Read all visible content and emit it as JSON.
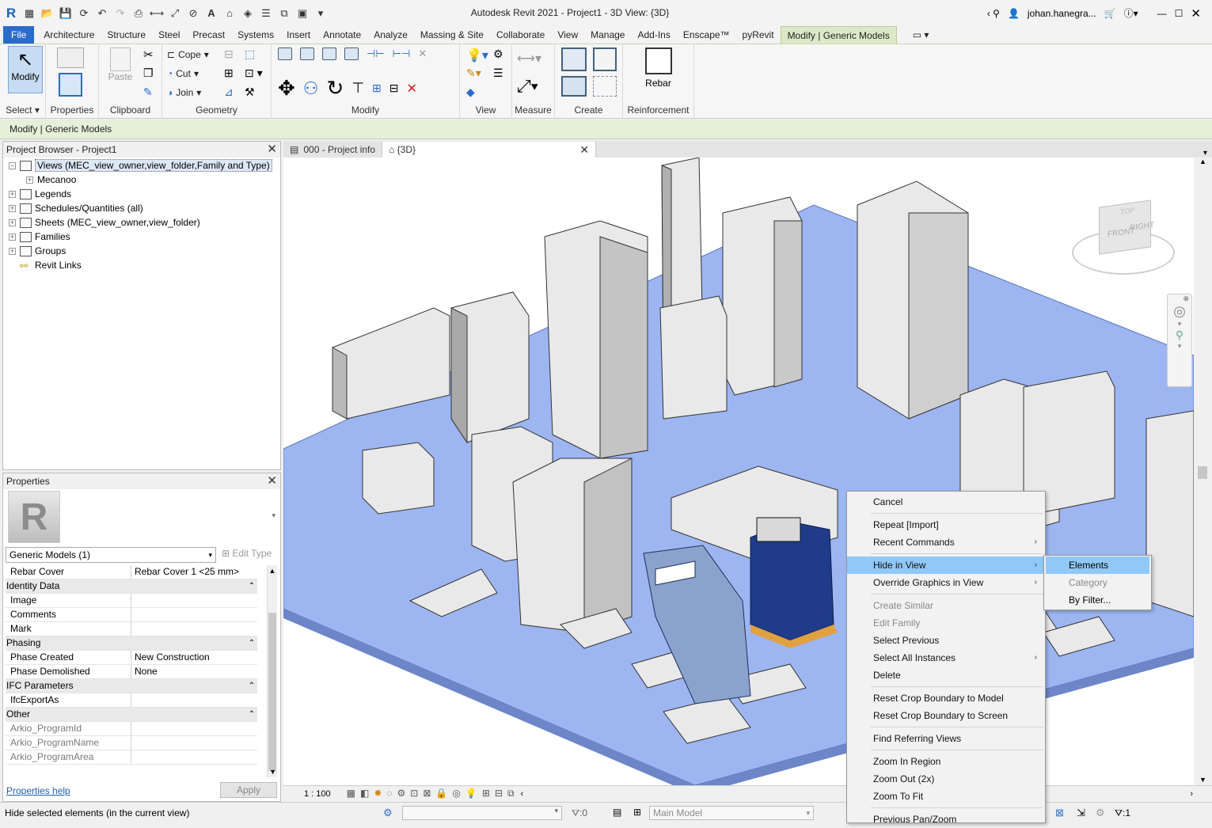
{
  "window": {
    "title": "Autodesk Revit 2021 - Project1 - 3D View: {3D}",
    "user": "johan.hanegra..."
  },
  "menu": {
    "file": "File",
    "tabs": [
      "Architecture",
      "Structure",
      "Steel",
      "Precast",
      "Systems",
      "Insert",
      "Annotate",
      "Analyze",
      "Massing & Site",
      "Collaborate",
      "View",
      "Manage",
      "Add-Ins",
      "Enscape™",
      "pyRevit"
    ],
    "active_tab": "Modify | Generic Models"
  },
  "ribbon": {
    "modify_label": "Modify",
    "paste_label": "Paste",
    "cope_label": "Cope",
    "cut_label": "Cut",
    "join_label": "Join",
    "rebar_label": "Rebar",
    "panels": {
      "select": "Select",
      "properties": "Properties",
      "clipboard": "Clipboard",
      "geometry": "Geometry",
      "modify": "Modify",
      "view": "View",
      "measure": "Measure",
      "create": "Create",
      "reinforcement": "Reinforcement"
    }
  },
  "context_bar": "Modify | Generic Models",
  "project_browser": {
    "title": "Project Browser - Project1",
    "items": [
      {
        "label": "Views (MEC_view_owner,view_folder,Family and Type)",
        "level": 0,
        "selected": true
      },
      {
        "label": "Mecanoo",
        "level": 1
      },
      {
        "label": "Legends",
        "level": 0
      },
      {
        "label": "Schedules/Quantities (all)",
        "level": 0
      },
      {
        "label": "Sheets (MEC_view_owner,view_folder)",
        "level": 0
      },
      {
        "label": "Families",
        "level": 0
      },
      {
        "label": "Groups",
        "level": 0
      },
      {
        "label": "Revit Links",
        "level": 0
      }
    ]
  },
  "properties": {
    "title": "Properties",
    "type_selector": "Generic Models (1)",
    "edit_type": "Edit Type",
    "rows": [
      {
        "kind": "prop",
        "key": "Rebar Cover",
        "value": "Rebar Cover 1 <25 mm>"
      },
      {
        "kind": "group",
        "key": "Identity Data"
      },
      {
        "kind": "prop",
        "key": "Image",
        "value": ""
      },
      {
        "kind": "prop",
        "key": "Comments",
        "value": ""
      },
      {
        "kind": "prop",
        "key": "Mark",
        "value": ""
      },
      {
        "kind": "group",
        "key": "Phasing"
      },
      {
        "kind": "prop",
        "key": "Phase Created",
        "value": "New Construction"
      },
      {
        "kind": "prop",
        "key": "Phase Demolished",
        "value": "None"
      },
      {
        "kind": "group",
        "key": "IFC Parameters"
      },
      {
        "kind": "prop",
        "key": "IfcExportAs",
        "value": ""
      },
      {
        "kind": "group",
        "key": "Other"
      },
      {
        "kind": "dim",
        "key": "Arkio_ProgramId",
        "value": ""
      },
      {
        "kind": "dim",
        "key": "Arkio_ProgramName",
        "value": ""
      },
      {
        "kind": "dim",
        "key": "Arkio_ProgramArea",
        "value": ""
      }
    ],
    "help_link": "Properties help",
    "apply": "Apply"
  },
  "view_tabs": [
    {
      "label": "000 - Project info",
      "active": false
    },
    {
      "label": "{3D}",
      "active": true
    }
  ],
  "viewcube": {
    "top": "TOP",
    "front": "FRONT",
    "right": "RIGHT"
  },
  "view_control": {
    "scale": "1 : 100"
  },
  "status_bar": {
    "message": "Hide selected elements (in the current view)",
    "selection_count": ":0",
    "model": "Main Model",
    "filter_count": ":1"
  },
  "context_menu": {
    "items": [
      {
        "label": "Cancel"
      },
      {
        "sep": true
      },
      {
        "label": "Repeat [Import]"
      },
      {
        "label": "Recent Commands",
        "submenu": true
      },
      {
        "sep": true
      },
      {
        "label": "Hide in View",
        "submenu": true,
        "highlight": true
      },
      {
        "label": "Override Graphics in View",
        "submenu": true
      },
      {
        "sep": true
      },
      {
        "label": "Create Similar",
        "disabled": true
      },
      {
        "label": "Edit Family",
        "disabled": true
      },
      {
        "label": "Select Previous"
      },
      {
        "label": "Select All Instances",
        "submenu": true
      },
      {
        "label": "Delete"
      },
      {
        "sep": true
      },
      {
        "label": "Reset Crop Boundary to Model"
      },
      {
        "label": "Reset Crop Boundary to Screen"
      },
      {
        "sep": true
      },
      {
        "label": "Find Referring Views"
      },
      {
        "sep": true
      },
      {
        "label": "Zoom In Region"
      },
      {
        "label": "Zoom Out (2x)"
      },
      {
        "label": "Zoom To Fit"
      },
      {
        "sep": true
      },
      {
        "label": "Previous Pan/Zoom"
      }
    ],
    "submenu": [
      {
        "label": "Elements",
        "highlight": true
      },
      {
        "label": "Category",
        "disabled": true
      },
      {
        "label": "By Filter..."
      }
    ]
  }
}
